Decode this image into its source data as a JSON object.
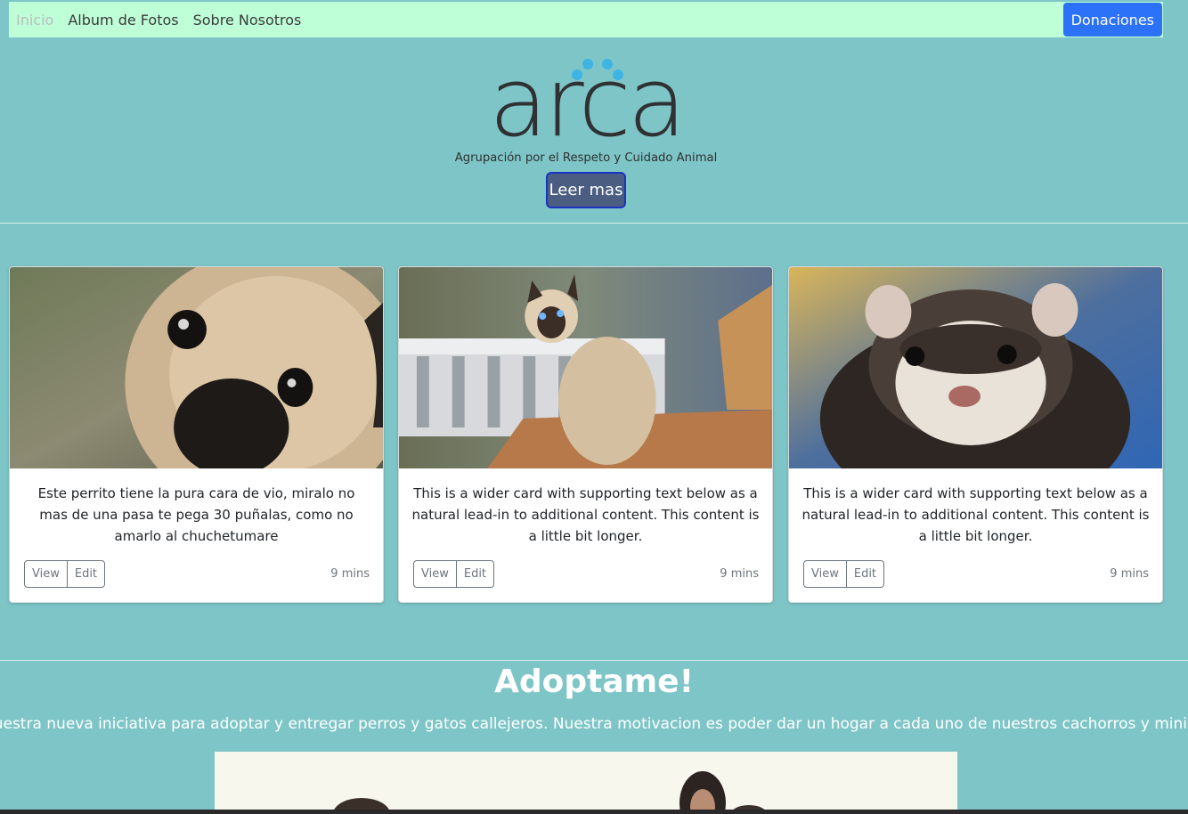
{
  "nav": {
    "links": [
      "Inicio",
      "Album de Fotos",
      "Sobre Nosotros"
    ],
    "donate_label": "Donaciones"
  },
  "hero": {
    "logo_text": "arca",
    "logo_tagline": "Agrupación por el Respeto y Cuidado Animal",
    "cta_label": "Leer mas"
  },
  "cards": [
    {
      "image": "pug-dog-photo",
      "text": "Este perrito tiene la pura cara de vio, miralo no mas de una pasa te pega 30 puñalas, como no amarlo al chuchetumare",
      "view_label": "View",
      "edit_label": "Edit",
      "time": "9 mins"
    },
    {
      "image": "siamese-cat-photo",
      "text": "This is a wider card with supporting text below as a natural lead-in to additional content. This content is a little bit longer.",
      "view_label": "View",
      "edit_label": "Edit",
      "time": "9 mins"
    },
    {
      "image": "ferret-photo",
      "text": "This is a wider card with supporting text below as a natural lead-in to additional content. This content is a little bit longer.",
      "view_label": "View",
      "edit_label": "Edit",
      "time": "9 mins"
    }
  ],
  "adopt": {
    "title": "Adoptame!",
    "text": "Nuestra nueva iniciativa para adoptar y entregar perros y gatos callejeros. Nuestra motivacion es poder dar un hogar a cada uno de nuestros cachorros y mininos."
  },
  "colors": {
    "background": "#7ec5c7",
    "navbar": "#bfffd8",
    "primary": "#2c72f8",
    "logo_dark": "#2f3133",
    "logo_blue": "#3eb4e3"
  }
}
